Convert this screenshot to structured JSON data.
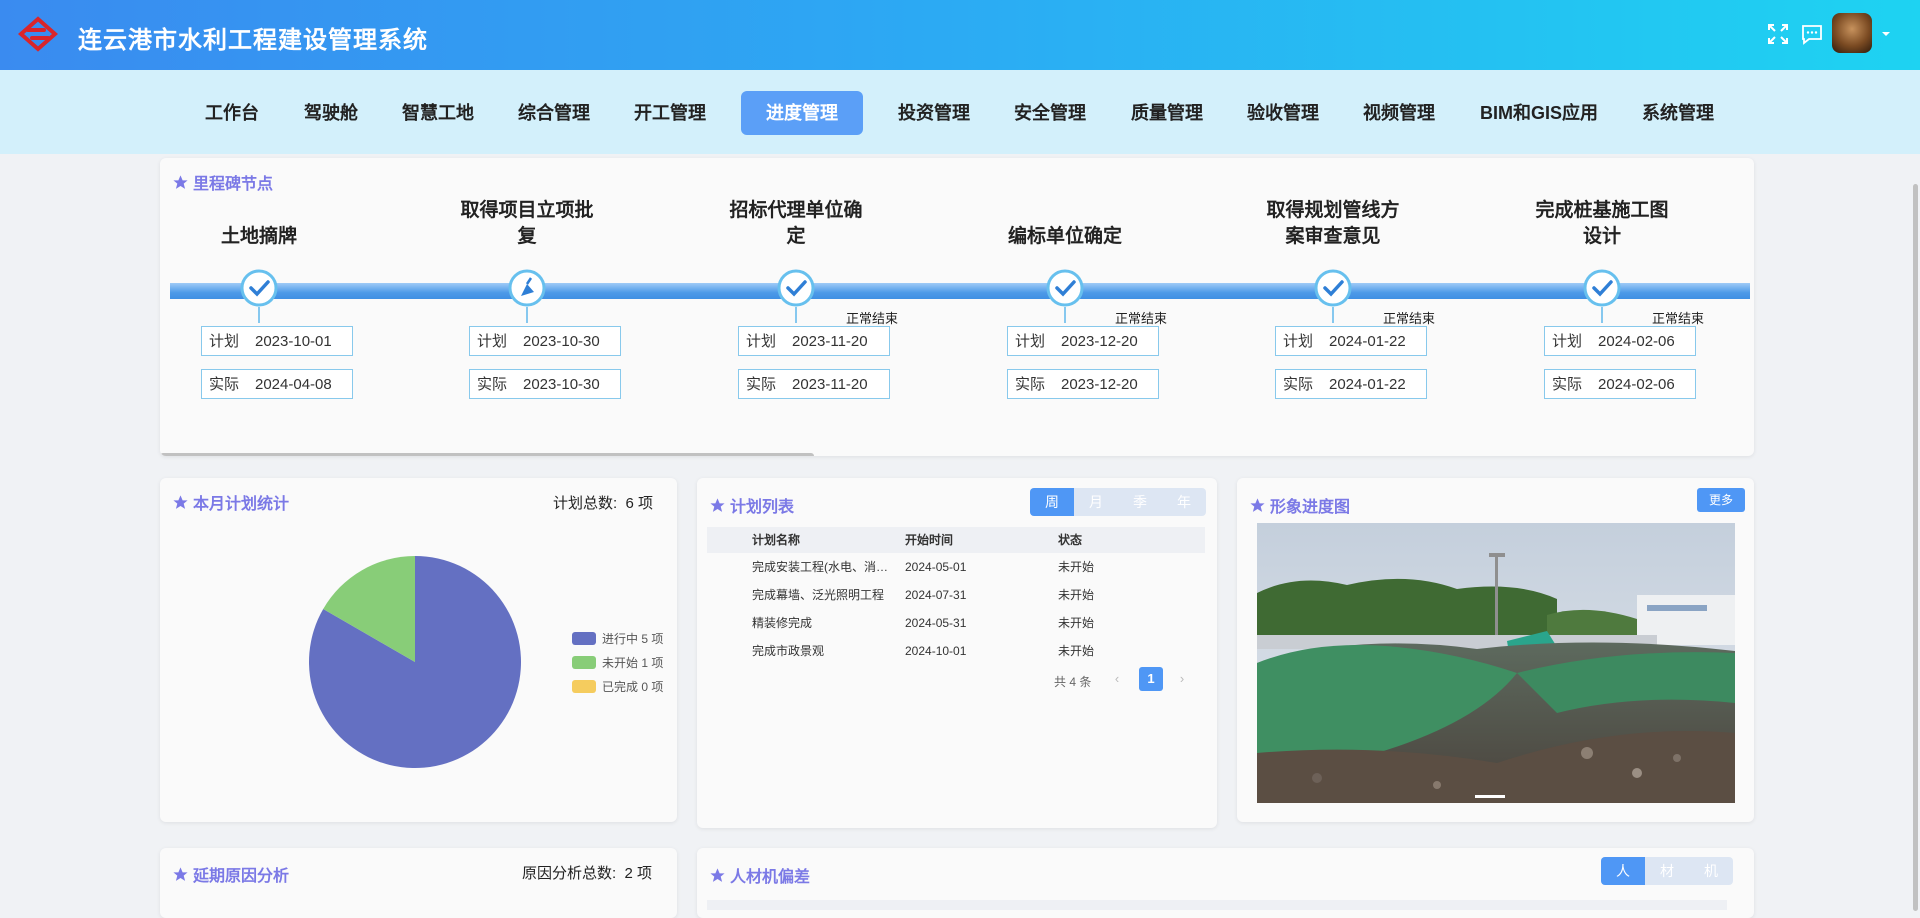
{
  "header": {
    "title": "连云港市水利工程建设管理系统"
  },
  "nav": {
    "items": [
      "工作台",
      "驾驶舱",
      "智慧工地",
      "综合管理",
      "开工管理",
      "进度管理",
      "投资管理",
      "安全管理",
      "质量管理",
      "验收管理",
      "视频管理",
      "BIM和GIS应用",
      "系统管理"
    ],
    "active": "进度管理"
  },
  "milestones": {
    "title": "里程碑节点",
    "plan_label": "计划",
    "actual_label": "实际",
    "items": [
      {
        "line1": "土地摘牌",
        "line2": "",
        "plan": "2023-10-01",
        "actual": "2024-04-08",
        "status": "",
        "icon": "check-icon"
      },
      {
        "line1": "取得项目立项批",
        "line2": "复",
        "plan": "2023-10-30",
        "actual": "2023-10-30",
        "status": "",
        "icon": "flag-icon"
      },
      {
        "line1": "招标代理单位确",
        "line2": "定",
        "plan": "2023-11-20",
        "actual": "2023-11-20",
        "status": "正常结束",
        "icon": "check-icon"
      },
      {
        "line1": "编标单位确定",
        "line2": "",
        "plan": "2023-12-20",
        "actual": "2023-12-20",
        "status": "正常结束",
        "icon": "check-icon"
      },
      {
        "line1": "取得规划管线方",
        "line2": "案审查意见",
        "plan": "2024-01-22",
        "actual": "2024-01-22",
        "status": "正常结束",
        "icon": "check-icon"
      },
      {
        "line1": "完成桩基施工图",
        "line2": "设计",
        "plan": "2024-02-06",
        "actual": "2024-02-06",
        "status": "正常结束",
        "icon": "check-icon"
      }
    ]
  },
  "monthly": {
    "title": "本月计划统计",
    "total_label": "计划总数:",
    "total": "6 项",
    "legend": [
      {
        "label": "进行中 5 项",
        "color": "#6470c2"
      },
      {
        "label": "未开始 1 项",
        "color": "#88cd78"
      },
      {
        "label": "已完成 0 项",
        "color": "#f5cc5e"
      }
    ]
  },
  "chart_data": {
    "type": "pie",
    "title": "",
    "categories": [
      "进行中",
      "未开始",
      "已完成"
    ],
    "values": [
      5,
      1,
      0
    ],
    "colors": [
      "#6470c2",
      "#88cd78",
      "#f5cc5e"
    ],
    "legend_position": "right"
  },
  "plan_list": {
    "title": "计划列表",
    "tabs": [
      "周",
      "月",
      "季",
      "年"
    ],
    "active_tab": "周",
    "headers": [
      "计划名称",
      "开始时间",
      "状态"
    ],
    "rows": [
      [
        "完成安装工程(水电、消防等)",
        "2024-05-01",
        "未开始"
      ],
      [
        "完成幕墙、泛光照明工程",
        "2024-07-31",
        "未开始"
      ],
      [
        "精装修完成",
        "2024-05-31",
        "未开始"
      ],
      [
        "完成市政景观",
        "2024-10-01",
        "未开始"
      ]
    ],
    "total": "共 4 条",
    "page": "1"
  },
  "image_progress": {
    "title": "形象进度图",
    "more": "更多"
  },
  "delay": {
    "title": "延期原因分析",
    "total_label": "原因分析总数:",
    "total": "2 项"
  },
  "deviation": {
    "title": "人材机偏差",
    "tabs": [
      "人",
      "材",
      "机"
    ],
    "active_tab": "人"
  }
}
